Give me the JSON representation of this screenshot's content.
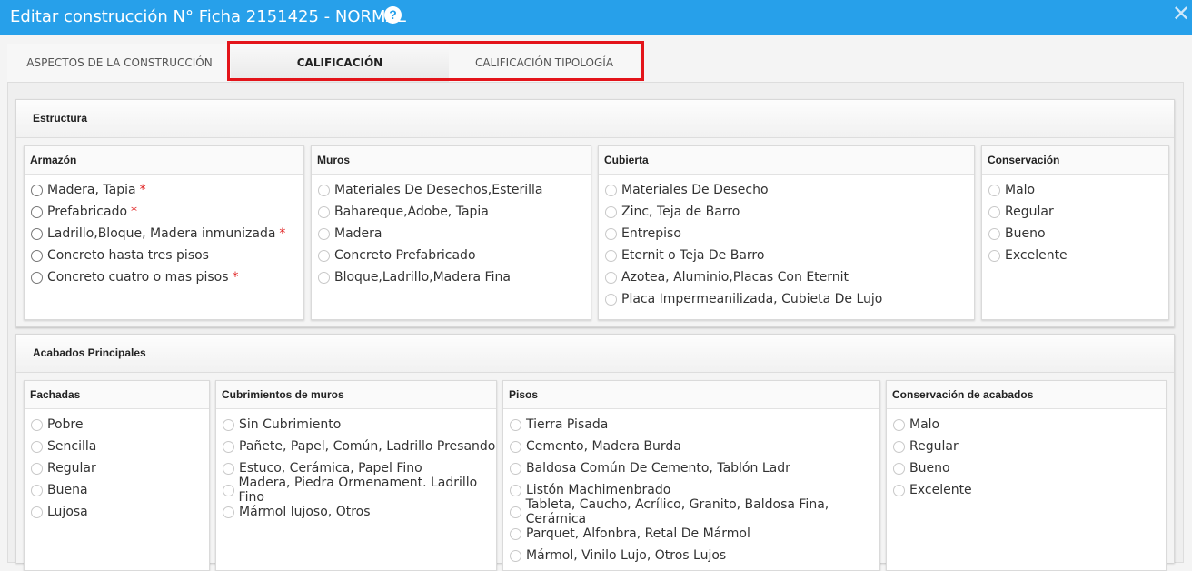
{
  "window": {
    "title": "Editar construcción N° Ficha 2151425 - NORMAL",
    "help": "?",
    "close": "✕"
  },
  "tabs": [
    "ASPECTOS DE LA CONSTRUCCIÓN",
    "CALIFICACIÓN",
    "CALIFICACIÓN TIPOLOGÍA"
  ],
  "estructura": {
    "title": "Estructura",
    "armazon": {
      "title": "Armazón",
      "options": [
        "Madera, Tapia",
        "Prefabricado",
        "Ladrillo,Bloque, Madera inmunizada",
        "Concreto hasta tres pisos",
        "Concreto cuatro o mas pisos"
      ],
      "required_mark": "*"
    },
    "muros": {
      "title": "Muros",
      "options": [
        "Materiales De Desechos,Esterilla",
        "Bahareque,Adobe, Tapia",
        "Madera",
        "Concreto Prefabricado",
        "Bloque,Ladrillo,Madera Fina"
      ]
    },
    "cubierta": {
      "title": "Cubierta",
      "options": [
        "Materiales De Desecho",
        "Zinc, Teja de Barro",
        "Entrepiso",
        "Eternit o Teja De Barro",
        "Azotea, Aluminio,Placas Con Eternit",
        "Placa Impermeanilizada, Cubieta De Lujo"
      ]
    },
    "conservacion": {
      "title": "Conservación",
      "options": [
        "Malo",
        "Regular",
        "Bueno",
        "Excelente"
      ]
    }
  },
  "acabados": {
    "title": "Acabados Principales",
    "fachadas": {
      "title": "Fachadas",
      "options": [
        "Pobre",
        "Sencilla",
        "Regular",
        "Buena",
        "Lujosa"
      ]
    },
    "cubrimientos": {
      "title": "Cubrimientos de muros",
      "options": [
        "Sin Cubrimiento",
        "Pañete, Papel, Común, Ladrillo Presando",
        "Estuco, Cerámica, Papel Fino",
        "Madera, Piedra Ormenament. Ladrillo Fino",
        "Mármol lujoso, Otros"
      ]
    },
    "pisos": {
      "title": "Pisos",
      "options": [
        "Tierra Pisada",
        "Cemento, Madera Burda",
        "Baldosa Común De Cemento, Tablón Ladr",
        "Listón Machimenbrado",
        "Tableta, Caucho, Acrílico, Granito, Baldosa Fina, Cerámica",
        "Parquet, Alfonbra, Retal De Mármol",
        "Mármol, Vinilo Lujo, Otros Lujos"
      ]
    },
    "conservacion": {
      "title": "Conservación de acabados",
      "options": [
        "Malo",
        "Regular",
        "Bueno",
        "Excelente"
      ]
    }
  }
}
